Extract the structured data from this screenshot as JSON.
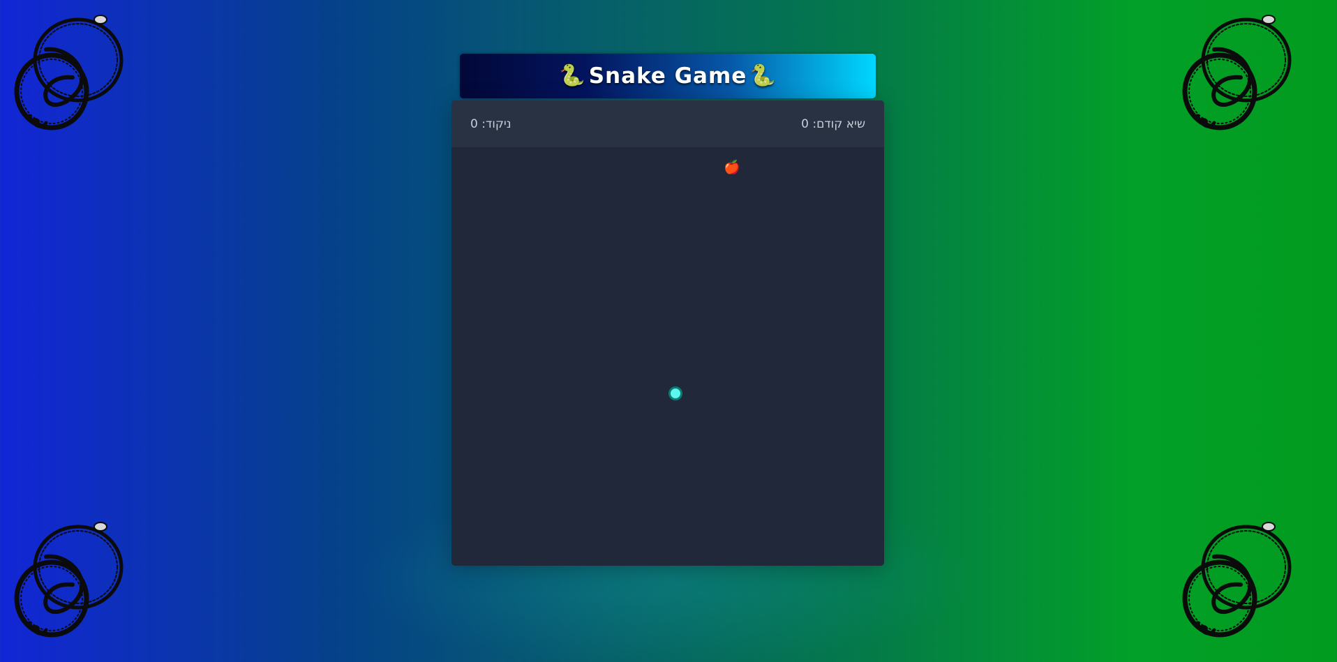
{
  "header": {
    "title": "Snake Game",
    "title_icon": "🐍",
    "title_icon_name": "snake-icon"
  },
  "scoreboard": {
    "high_score_label": "שיא קודם:",
    "high_score": 0,
    "score_label": "ניקוד:",
    "score": 0
  },
  "board": {
    "food_icon": "🍎",
    "food_icon_name": "apple-icon",
    "snake_color": "#5ef6f0",
    "snake_border_color": "#0a7d72",
    "background_color": "#212839"
  },
  "decorations": {
    "corner_icon_name": "coiled-snake-icon"
  },
  "colors": {
    "background_left": "#1226d6",
    "background_right": "#019b1e",
    "banner_left": "#020838",
    "banner_right": "#00d8ff",
    "score_bar": "#283243",
    "score_text": "#c9ced8"
  }
}
